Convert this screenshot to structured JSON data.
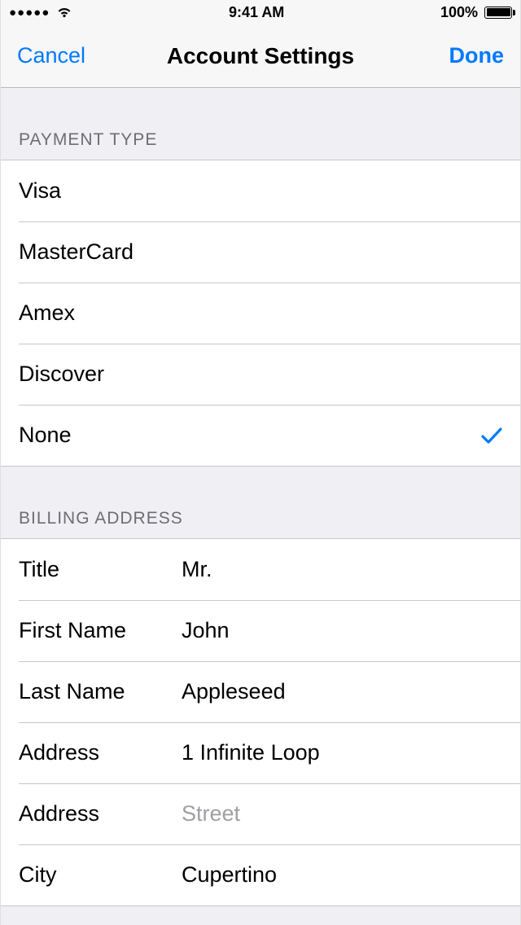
{
  "status": {
    "time": "9:41 AM",
    "battery": "100%"
  },
  "nav": {
    "cancel": "Cancel",
    "title": "Account Settings",
    "done": "Done"
  },
  "payment": {
    "header": "PAYMENT TYPE",
    "options": {
      "visa": "Visa",
      "mastercard": "MasterCard",
      "amex": "Amex",
      "discover": "Discover",
      "none": "None"
    },
    "selected": "none"
  },
  "billing": {
    "header": "BILLING ADDRESS",
    "fields": {
      "title_label": "Title",
      "title_value": "Mr.",
      "first_name_label": "First Name",
      "first_name_value": "John",
      "last_name_label": "Last Name",
      "last_name_value": "Appleseed",
      "address1_label": "Address",
      "address1_value": "1 Infinite Loop",
      "address2_label": "Address",
      "address2_placeholder": "Street",
      "city_label": "City",
      "city_value": "Cupertino"
    }
  }
}
